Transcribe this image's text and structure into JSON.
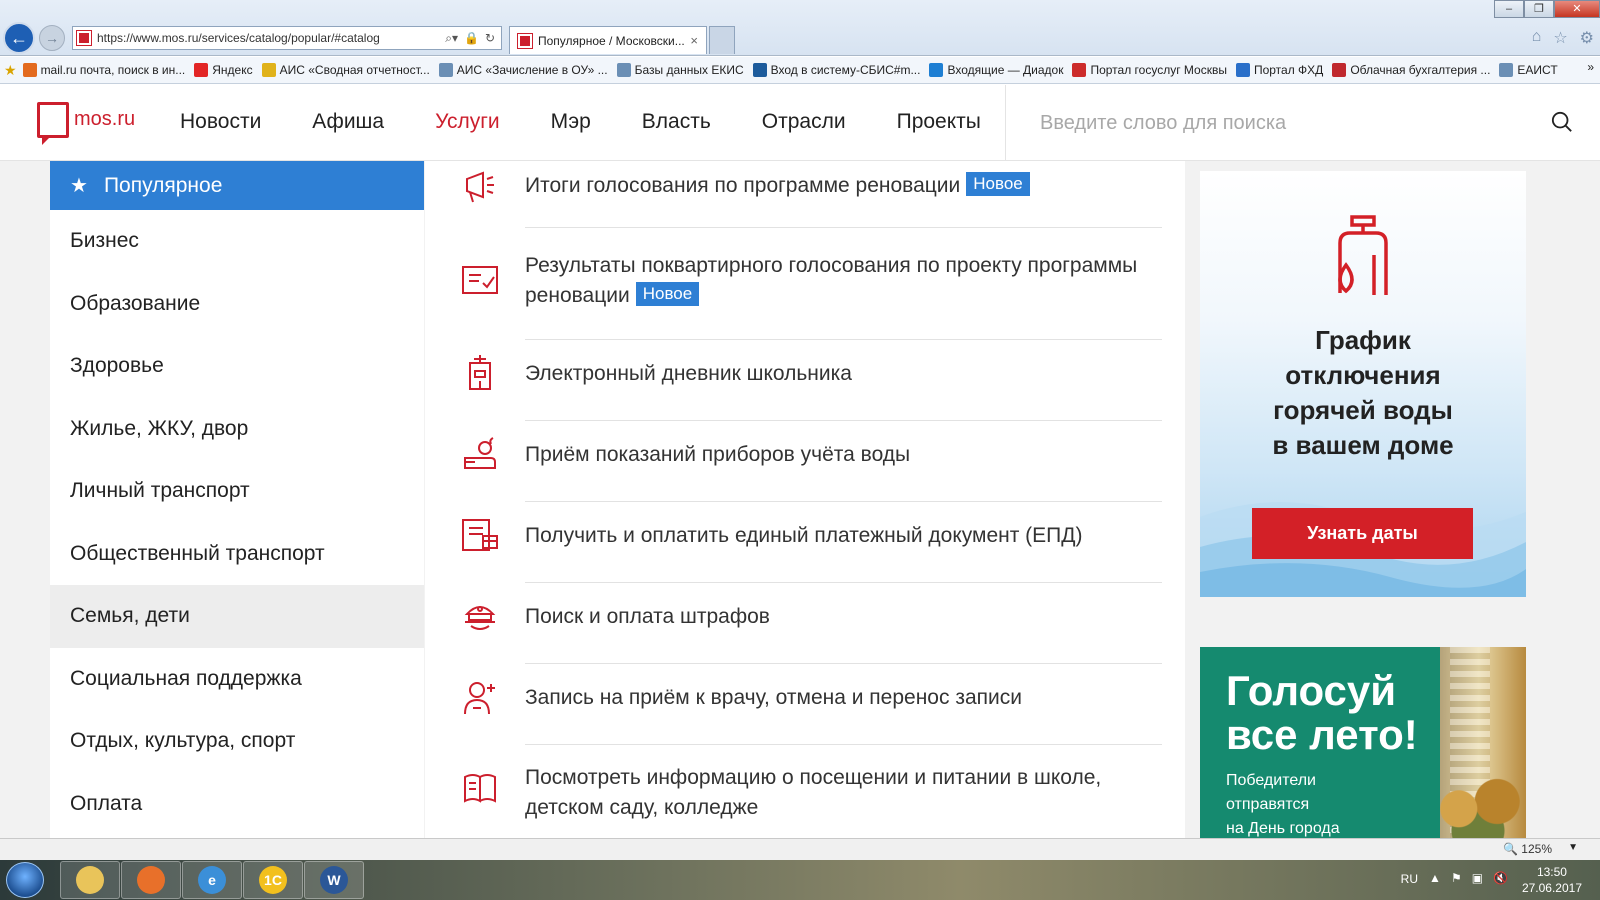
{
  "browser": {
    "url": "https://www.mos.ru/services/catalog/popular/#catalog",
    "tab_title": "Популярное / Московски...",
    "tab_close": "×",
    "favorites": [
      {
        "label": "mail.ru почта, поиск в ин...",
        "icon": "mailru-icon",
        "color": "#e36a1e"
      },
      {
        "label": "Яндекс",
        "icon": "yandex-icon",
        "color": "#e22525"
      },
      {
        "label": "АИС «Сводная отчетност...",
        "icon": "crown-icon",
        "color": "#e0b21a"
      },
      {
        "label": "АИС «Зачисление в ОУ» ...",
        "icon": "page-icon",
        "color": "#6b8fb5"
      },
      {
        "label": "Базы данных ЕКИС",
        "icon": "db-icon",
        "color": "#6b8fb5"
      },
      {
        "label": "Вход в систему-СБИС#m...",
        "icon": "sbis-icon",
        "color": "#1d5c9c"
      },
      {
        "label": "Входящие — Диадок",
        "icon": "diadoc-icon",
        "color": "#1e7fd3"
      },
      {
        "label": "Портал госуслуг Москвы",
        "icon": "gosuslugi-icon",
        "color": "#cc2b2b"
      },
      {
        "label": "Портал ФХД",
        "icon": "fhd-icon",
        "color": "#2a6fc9"
      },
      {
        "label": "Облачная бухгалтерия ...",
        "icon": "cloud-icon",
        "color": "#c0282e"
      },
      {
        "label": "ЕАИСТ",
        "icon": "eaist-icon",
        "color": "#6b8fb5"
      }
    ],
    "zoom": "125%"
  },
  "site": {
    "logo_text": "mos.ru",
    "nav": [
      "Новости",
      "Афиша",
      "Услуги",
      "Мэр",
      "Власть",
      "Отрасли",
      "Проекты"
    ],
    "nav_active_index": 2,
    "search_placeholder": "Введите слово для поиска",
    "accent_color": "#cc1f2d",
    "blue_color": "#2e7fd4"
  },
  "sidebar": {
    "items": [
      {
        "label": "Популярное",
        "state": "active"
      },
      {
        "label": "Бизнес"
      },
      {
        "label": "Образование"
      },
      {
        "label": "Здоровье"
      },
      {
        "label": "Жилье, ЖКУ, двор"
      },
      {
        "label": "Личный транспорт"
      },
      {
        "label": "Общественный транспорт"
      },
      {
        "label": "Семья, дети",
        "state": "highlight"
      },
      {
        "label": "Социальная поддержка"
      },
      {
        "label": "Отдых, культура, спорт"
      },
      {
        "label": "Оплата"
      }
    ]
  },
  "services": [
    {
      "text": "Итоги голосования по программе реновации",
      "badge": "Новое",
      "icon": "megaphone-icon"
    },
    {
      "text": "Результаты поквартирного голосования по проекту программы реновации",
      "badge": "Новое",
      "icon": "checklist-icon"
    },
    {
      "text": "Электронный дневник школьника",
      "icon": "school-building-icon"
    },
    {
      "text": "Приём показаний приборов учёта воды",
      "icon": "water-meter-icon"
    },
    {
      "text": "Получить и оплатить единый платежный документ (ЕПД)",
      "icon": "payment-document-icon"
    },
    {
      "text": "Поиск и оплата штрафов",
      "icon": "police-cap-icon"
    },
    {
      "text": "Запись на приём к врачу, отмена и перенос записи",
      "icon": "doctor-icon"
    },
    {
      "text": "Посмотреть информацию о посещении и питании в школе, детском саду, колледже",
      "icon": "book-icon"
    }
  ],
  "banners": {
    "water": {
      "title_lines": [
        "График",
        "отключения",
        "горячей воды",
        "в вашем доме"
      ],
      "button": "Узнать даты"
    },
    "vote": {
      "title_lines": [
        "Голосуй",
        "все лето!"
      ],
      "sub_lines": [
        "Победители",
        "отправятся",
        "на День города"
      ]
    }
  },
  "taskbar": {
    "apps": [
      {
        "name": "explorer",
        "label": ""
      },
      {
        "name": "firefox",
        "label": ""
      },
      {
        "name": "internet-explorer",
        "label": "e"
      },
      {
        "name": "1c",
        "label": "1С"
      },
      {
        "name": "word",
        "label": "W"
      }
    ],
    "lang": "RU",
    "time": "13:50",
    "date": "27.06.2017"
  }
}
